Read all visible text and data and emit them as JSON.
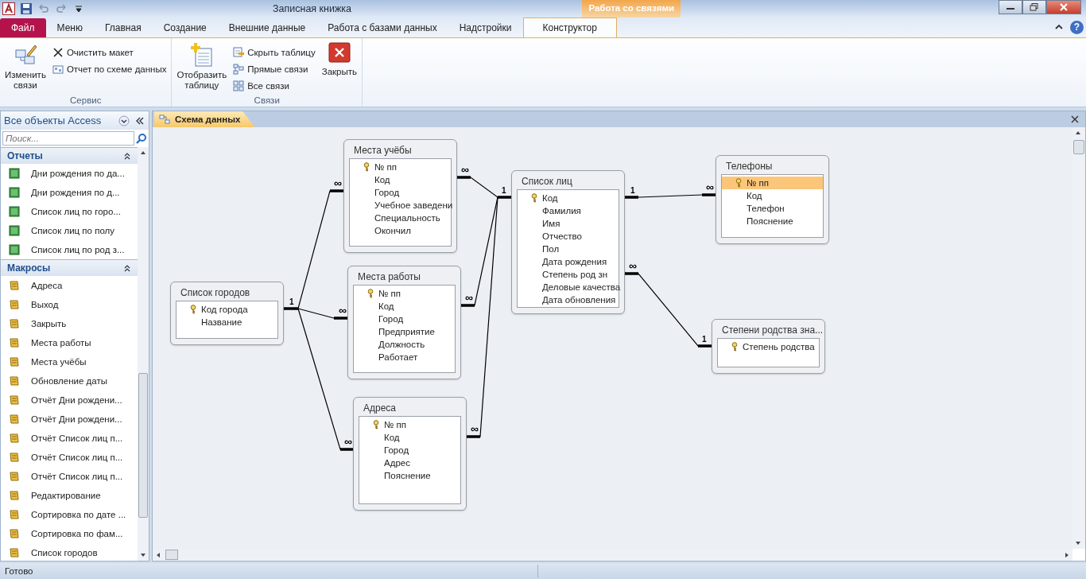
{
  "window": {
    "title": "Записная книжка",
    "context_tab": "Работа со связями"
  },
  "ribbon_tabs": [
    {
      "label": "Файл",
      "kind": "file",
      "selected": false
    },
    {
      "label": "Меню",
      "kind": "tab",
      "selected": false
    },
    {
      "label": "Главная",
      "kind": "tab",
      "selected": false
    },
    {
      "label": "Создание",
      "kind": "tab",
      "selected": false
    },
    {
      "label": "Внешние данные",
      "kind": "tab",
      "selected": false
    },
    {
      "label": "Работа с базами данных",
      "kind": "tab",
      "selected": false
    },
    {
      "label": "Надстройки",
      "kind": "tab",
      "selected": false
    },
    {
      "label": "Конструктор",
      "kind": "tab",
      "selected": true
    }
  ],
  "ribbon_groups": [
    {
      "label": "Сервис",
      "large": {
        "label": "Изменить\nсвязи",
        "kind": "edit"
      },
      "small": [
        {
          "label": "Очистить макет",
          "kind": "clear"
        },
        {
          "label": "Отчет по схеме данных",
          "kind": "report"
        }
      ]
    },
    {
      "label": "Связи",
      "large": {
        "label": "Отобразить\nтаблицу",
        "kind": "show"
      },
      "small": [
        {
          "label": "Скрыть таблицу",
          "kind": "hide"
        },
        {
          "label": "Прямые связи",
          "kind": "direct"
        },
        {
          "label": "Все связи",
          "kind": "all"
        }
      ],
      "extra": {
        "label": "Закрыть",
        "kind": "close"
      }
    }
  ],
  "nav_pane": {
    "title": "Все объекты Access",
    "search": {
      "placeholder": "Поиск..."
    },
    "groups": [
      {
        "label": "Отчеты",
        "kind": "report",
        "items": [
          "Дни рождения по да...",
          "Дни рождения по д...",
          "Список лиц по горо...",
          "Список лиц по полу",
          "Список лиц по род з..."
        ]
      },
      {
        "label": "Макросы",
        "kind": "macro",
        "items": [
          "Адреса",
          "Выход",
          "Закрыть",
          "Места работы",
          "Места учёбы",
          "Обновление даты",
          "Отчёт Дни рождени...",
          "Отчёт Дни рождени...",
          "Отчёт Список лиц п...",
          "Отчёт Список лиц п...",
          "Отчёт Список лиц п...",
          "Редактирование",
          "Сортировка по дате ...",
          "Сортировка по фам...",
          "Список городов"
        ]
      }
    ]
  },
  "document_tab": {
    "label": "Схема данных"
  },
  "tables": [
    {
      "title": "Места учёбы",
      "fields": [
        {
          "name": "№ пп",
          "key": true,
          "selected": false
        },
        {
          "name": "Код",
          "key": false,
          "selected": false
        },
        {
          "name": "Город",
          "key": false,
          "selected": false
        },
        {
          "name": "Учебное заведени",
          "key": false,
          "selected": false
        },
        {
          "name": "Специальность",
          "key": false,
          "selected": false
        },
        {
          "name": "Окончил",
          "key": false,
          "selected": false
        }
      ]
    },
    {
      "title": "Список лиц",
      "fields": [
        {
          "name": "Код",
          "key": true,
          "selected": false
        },
        {
          "name": "Фамилия",
          "key": false,
          "selected": false
        },
        {
          "name": "Имя",
          "key": false,
          "selected": false
        },
        {
          "name": "Отчество",
          "key": false,
          "selected": false
        },
        {
          "name": "Пол",
          "key": false,
          "selected": false
        },
        {
          "name": "Дата рождения",
          "key": false,
          "selected": false
        },
        {
          "name": "Степень род зн",
          "key": false,
          "selected": false
        },
        {
          "name": "Деловые качества",
          "key": false,
          "selected": false
        },
        {
          "name": "Дата обновления",
          "key": false,
          "selected": false
        }
      ]
    },
    {
      "title": "Телефоны",
      "fields": [
        {
          "name": "№ пп",
          "key": true,
          "selected": true
        },
        {
          "name": "Код",
          "key": false,
          "selected": false
        },
        {
          "name": "Телефон",
          "key": false,
          "selected": false
        },
        {
          "name": "Пояснение",
          "key": false,
          "selected": false
        }
      ]
    },
    {
      "title": "Список городов",
      "fields": [
        {
          "name": "Код города",
          "key": true,
          "selected": false
        },
        {
          "name": "Название",
          "key": false,
          "selected": false
        }
      ]
    },
    {
      "title": "Места работы",
      "fields": [
        {
          "name": "№ пп",
          "key": true,
          "selected": false
        },
        {
          "name": "Код",
          "key": false,
          "selected": false
        },
        {
          "name": "Город",
          "key": false,
          "selected": false
        },
        {
          "name": "Предприятие",
          "key": false,
          "selected": false
        },
        {
          "name": "Должность",
          "key": false,
          "selected": false
        },
        {
          "name": "Работает",
          "key": false,
          "selected": false
        }
      ]
    },
    {
      "title": "Степени родства зна...",
      "fields": [
        {
          "name": "Степень родства",
          "key": true,
          "selected": false
        }
      ]
    },
    {
      "title": "Адреса",
      "fields": [
        {
          "name": "№ пп",
          "key": true,
          "selected": false
        },
        {
          "name": "Код",
          "key": false,
          "selected": false
        },
        {
          "name": "Город",
          "key": false,
          "selected": false
        },
        {
          "name": "Адрес",
          "key": false,
          "selected": false
        },
        {
          "name": "Пояснение",
          "key": false,
          "selected": false
        }
      ]
    }
  ],
  "relationships": [
    {
      "one_label": "1",
      "many_label": "∞"
    },
    {
      "many_label": "∞"
    },
    {
      "many_label": "∞"
    },
    {
      "one_label": "1",
      "many_label": "∞"
    },
    {
      "many_label": "∞"
    },
    {
      "many_label": "∞"
    },
    {
      "one_label": "1",
      "many_label": "∞"
    },
    {
      "one_label": "1",
      "many_label": "∞"
    }
  ],
  "help_button": "?",
  "status_bar": {
    "text": "Готово"
  }
}
